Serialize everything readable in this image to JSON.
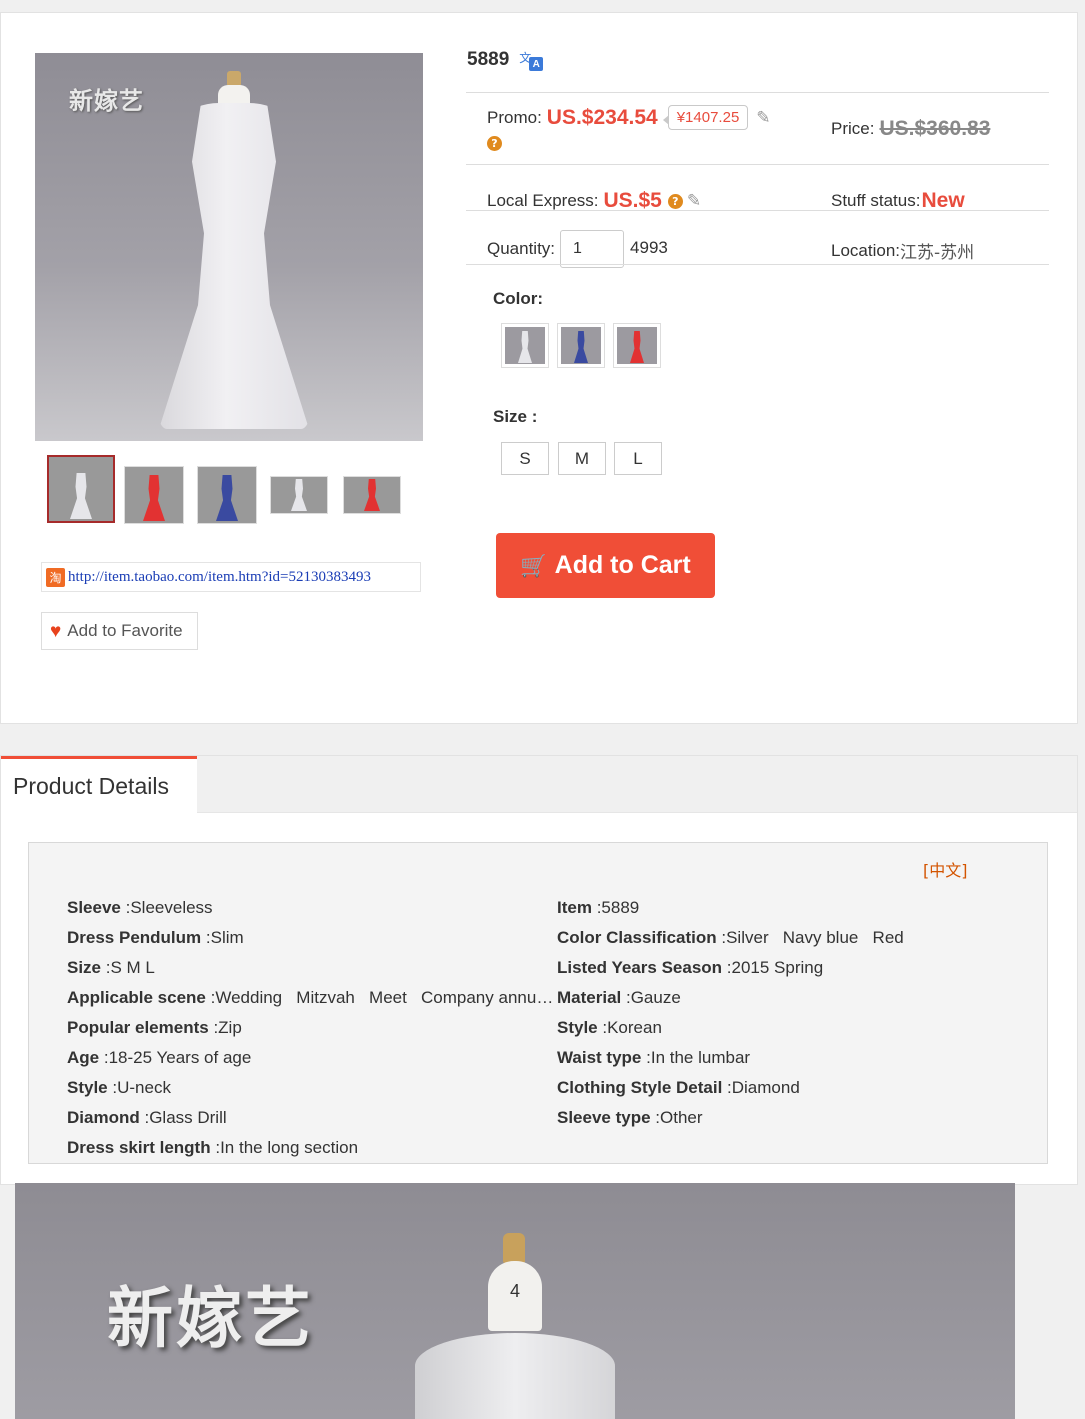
{
  "product": {
    "id": "5889",
    "watermark": "新嫁艺"
  },
  "pricing": {
    "promo_label": "Promo:",
    "promo_value": "US.$234.54",
    "cny_value": "¥1407.25",
    "price_label": "Price:",
    "price_value": "US.$360.83",
    "express_label": "Local Express:",
    "express_value": "US.$5",
    "status_label": "Stuff status:",
    "status_value": "New",
    "quantity_label": "Quantity:",
    "quantity_value": "1",
    "stock": "4993",
    "location_label": "Location:",
    "location_value": "江苏-苏州"
  },
  "options": {
    "color_label": "Color:",
    "colors": [
      {
        "name": "Silver",
        "hex": "#e6e6ea"
      },
      {
        "name": "Navy blue",
        "hex": "#3a4aa0"
      },
      {
        "name": "Red",
        "hex": "#e23232"
      }
    ],
    "size_label": "Size :",
    "sizes": [
      "S",
      "M",
      "L"
    ]
  },
  "actions": {
    "add_to_cart": "Add to Cart",
    "add_to_favorite": "Add to Favorite"
  },
  "source_link": {
    "icon_text": "淘",
    "text": "http://item.taobao.com/item.htm?id=52130383493"
  },
  "thumbnails": [
    {
      "hex": "#e6e6ea",
      "active": true
    },
    {
      "hex": "#e23232",
      "active": false
    },
    {
      "hex": "#3a4aa0",
      "active": false
    },
    {
      "hex": "#e6e6ea",
      "active": false
    },
    {
      "hex": "#e23232",
      "active": false
    }
  ],
  "details": {
    "tab_label": "Product Details",
    "lang_link": "[中文]",
    "left": [
      {
        "k": "Sleeve",
        "v": ":Sleeveless"
      },
      {
        "k": "Dress Pendulum",
        "v": ":Slim"
      },
      {
        "k": "Size",
        "v": ":S M L"
      },
      {
        "k": "Applicable scene",
        "v": ":Wedding   Mitzvah   Meet   Company annual meeting"
      },
      {
        "k": "Popular elements",
        "v": ":Zip"
      },
      {
        "k": "Age",
        "v": ":18-25 Years of age"
      },
      {
        "k": "Style",
        "v": ":U-neck"
      },
      {
        "k": "Diamond",
        "v": ":Glass Drill"
      },
      {
        "k": "Dress skirt length",
        "v": ":In the long section"
      }
    ],
    "right": [
      {
        "k": "Item",
        "v": ":5889"
      },
      {
        "k": "Color Classification",
        "v": ":Silver   Navy blue   Red"
      },
      {
        "k": "Listed Years Season",
        "v": ":2015 Spring"
      },
      {
        "k": "Material",
        "v": ":Gauze"
      },
      {
        "k": "Style",
        "v": ":Korean"
      },
      {
        "k": "Waist type",
        "v": ":In the lumbar"
      },
      {
        "k": "Clothing Style Detail",
        "v": ":Diamond"
      },
      {
        "k": "Sleeve type",
        "v": ":Other"
      }
    ]
  },
  "colors": {
    "accent": "#f04e37",
    "price_red": "#e84c3d",
    "link_blue": "#1a3db5",
    "lang_orange": "#d35400"
  }
}
